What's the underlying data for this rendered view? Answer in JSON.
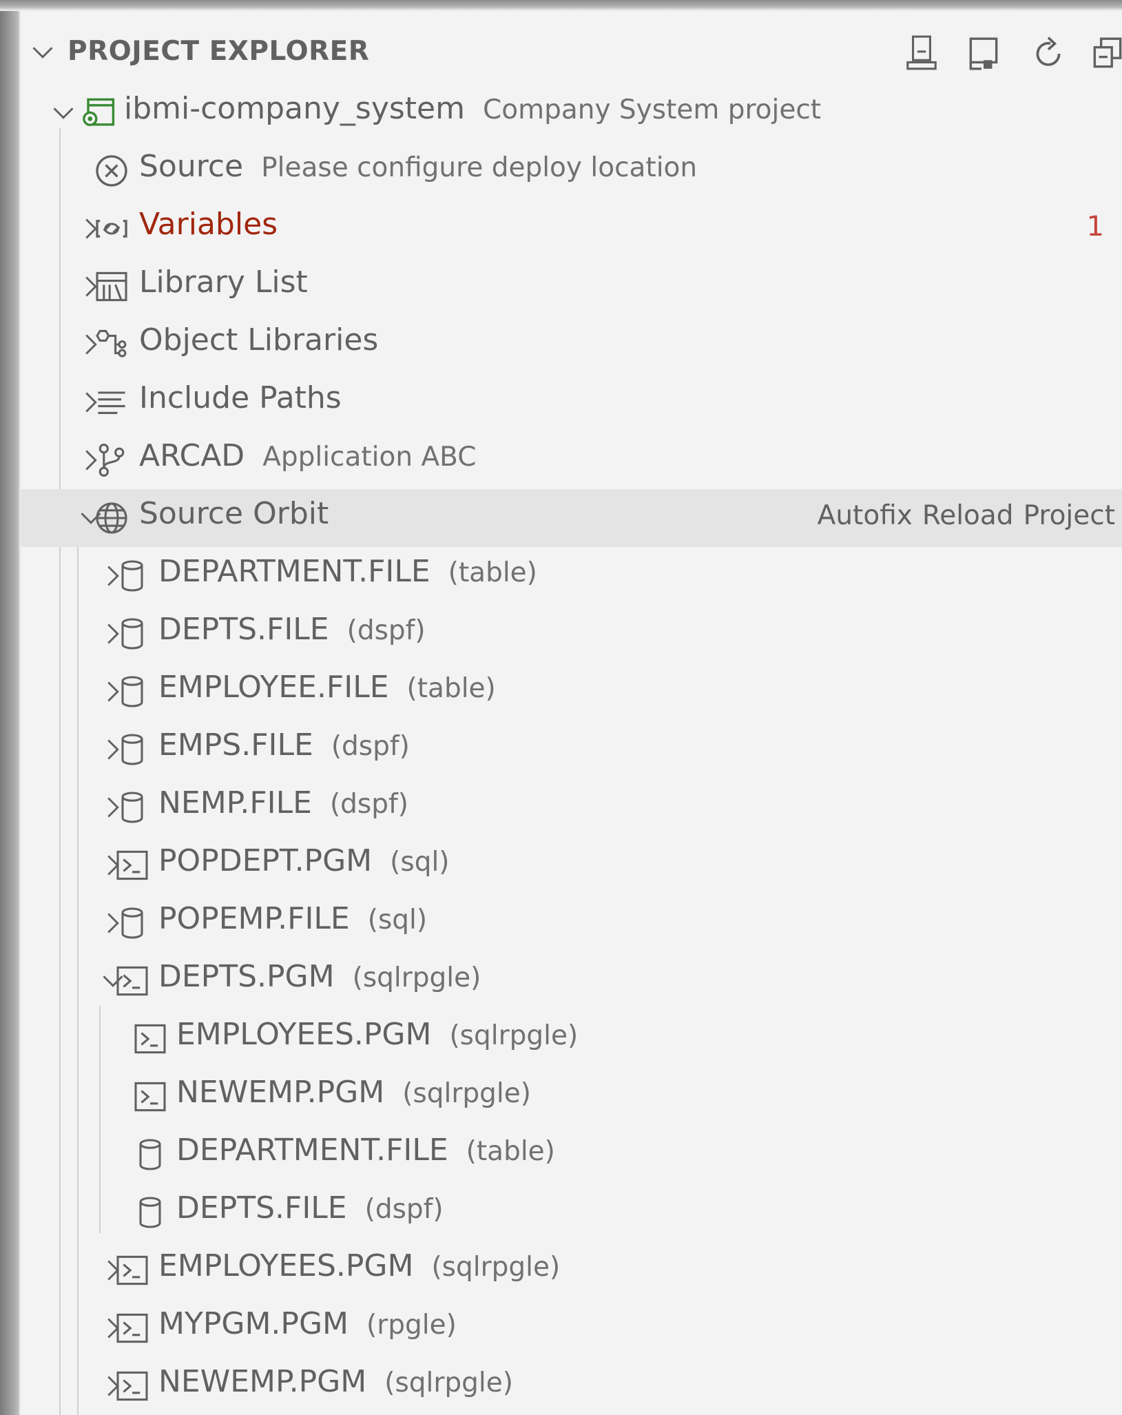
{
  "header": {
    "title": "PROJECT EXPLORER",
    "toolbar_icons": [
      "deploy-icon",
      "manage-icon",
      "refresh-icon",
      "collapse-all-icon"
    ]
  },
  "project": {
    "name": "ibmi-company_system",
    "description": "Company System project"
  },
  "items": {
    "source": {
      "label": "Source",
      "description": "Please configure deploy location",
      "icon": "error-circle-icon"
    },
    "variables": {
      "label": "Variables",
      "badge": "1",
      "icon": "symbol-variable-icon",
      "color": "#a1260d"
    },
    "library_list": {
      "label": "Library List",
      "icon": "library-list-icon"
    },
    "object_libraries": {
      "label": "Object Libraries",
      "icon": "type-hierarchy-icon"
    },
    "include_paths": {
      "label": "Include Paths",
      "icon": "list-flat-icon"
    },
    "arcad": {
      "label": "ARCAD",
      "description": "Application ABC",
      "icon": "source-control-icon"
    },
    "source_orbit": {
      "label": "Source Orbit",
      "icon": "globe-icon",
      "actions": [
        "Autofix",
        "Reload",
        "Project"
      ]
    }
  },
  "orbit_items": [
    {
      "name": "DEPARTMENT.FILE",
      "type": "(table)",
      "icon": "database-icon"
    },
    {
      "name": "DEPTS.FILE",
      "type": "(dspf)",
      "icon": "database-icon"
    },
    {
      "name": "EMPLOYEE.FILE",
      "type": "(table)",
      "icon": "database-icon"
    },
    {
      "name": "EMPS.FILE",
      "type": "(dspf)",
      "icon": "database-icon"
    },
    {
      "name": "NEMP.FILE",
      "type": "(dspf)",
      "icon": "database-icon"
    },
    {
      "name": "POPDEPT.PGM",
      "type": "(sql)",
      "icon": "terminal-icon"
    },
    {
      "name": "POPEMP.FILE",
      "type": "(sql)",
      "icon": "database-icon"
    },
    {
      "name": "DEPTS.PGM",
      "type": "(sqlrpgle)",
      "icon": "terminal-icon",
      "expanded": true,
      "children": [
        {
          "name": "EMPLOYEES.PGM",
          "type": "(sqlrpgle)",
          "icon": "terminal-icon"
        },
        {
          "name": "NEWEMP.PGM",
          "type": "(sqlrpgle)",
          "icon": "terminal-icon"
        },
        {
          "name": "DEPARTMENT.FILE",
          "type": "(table)",
          "icon": "database-icon"
        },
        {
          "name": "DEPTS.FILE",
          "type": "(dspf)",
          "icon": "database-icon"
        }
      ]
    },
    {
      "name": "EMPLOYEES.PGM",
      "type": "(sqlrpgle)",
      "icon": "terminal-icon"
    },
    {
      "name": "MYPGM.PGM",
      "type": "(rpgle)",
      "icon": "terminal-icon"
    },
    {
      "name": "NEWEMP.PGM",
      "type": "(sqlrpgle)",
      "icon": "terminal-icon"
    }
  ]
}
